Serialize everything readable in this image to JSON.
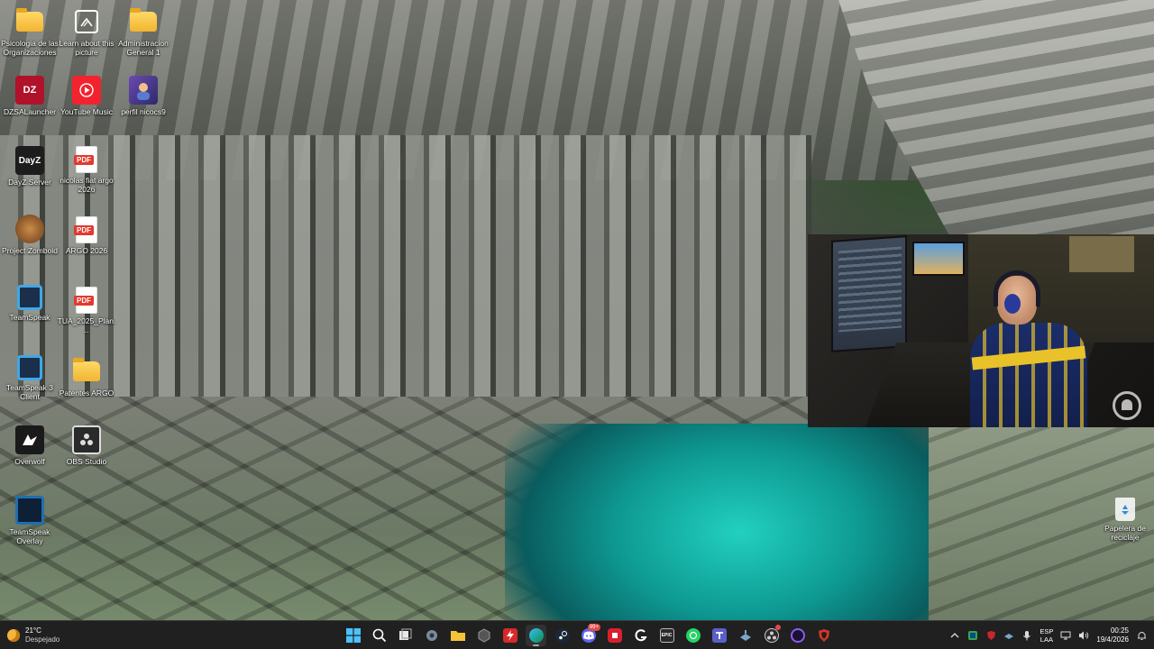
{
  "desktop": {
    "icons": [
      {
        "label": "Psicologia de las Organizaciones",
        "icon": "folder-icon"
      },
      {
        "label": "Learn about this picture",
        "icon": "camera-icon"
      },
      {
        "label": "Administracion General 1",
        "icon": "folder-icon"
      },
      {
        "label": "DZSALauncher",
        "icon": "dzsa-icon",
        "glyph": "DZ"
      },
      {
        "label": "YouTube Music",
        "icon": "youtube-music-icon"
      },
      {
        "label": "perfil nicocs9",
        "icon": "profile-image-icon"
      },
      {
        "label": "DayZ Server",
        "icon": "dayz-icon",
        "glyph": "DayZ"
      },
      {
        "label": "nicolas fiat argo 2026",
        "icon": "pdf-icon"
      },
      {
        "label": "Project Zomboid",
        "icon": "project-zomboid-icon"
      },
      {
        "label": "ARGO 2026",
        "icon": "pdf-icon"
      },
      {
        "label": "TeamSpeak",
        "icon": "teamspeak-icon"
      },
      {
        "label": "TUA_2025_Plan...",
        "icon": "pdf-icon"
      },
      {
        "label": "TeamSpeak 3 Client",
        "icon": "teamspeak-icon"
      },
      {
        "label": "Patentes ARGO",
        "icon": "folder-icon"
      },
      {
        "label": "Overwolf",
        "icon": "overwolf-icon"
      },
      {
        "label": "OBS Studio",
        "icon": "obs-icon"
      },
      {
        "label": "TeamSpeak Overlay",
        "icon": "teamspeak-overlay-icon"
      },
      {
        "label": "Papelera de reciclaje",
        "icon": "recycle-bin-icon"
      }
    ],
    "pdf_badge": "PDF"
  },
  "taskbar": {
    "weather": {
      "temp": "21°C",
      "condition": "Despejado",
      "icon": "moon-icon"
    },
    "apps": [
      {
        "name": "start",
        "icon": "windows-start-icon"
      },
      {
        "name": "search",
        "icon": "search-icon"
      },
      {
        "name": "task-view",
        "icon": "task-view-icon"
      },
      {
        "name": "settings",
        "icon": "settings-icon"
      },
      {
        "name": "file-explorer",
        "icon": "folder-icon"
      },
      {
        "name": "app-cube",
        "icon": "cube-icon"
      },
      {
        "name": "app-bolt",
        "icon": "lightning-icon"
      },
      {
        "name": "edge",
        "icon": "edge-icon",
        "active": true
      },
      {
        "name": "steam",
        "icon": "steam-icon"
      },
      {
        "name": "discord",
        "icon": "discord-icon",
        "badge": "99+"
      },
      {
        "name": "app-red",
        "icon": "app-red-icon"
      },
      {
        "name": "app-g",
        "icon": "g-hub-icon"
      },
      {
        "name": "epic-games",
        "icon": "epic-games-icon",
        "glyph": "EPIC"
      },
      {
        "name": "whatsapp",
        "icon": "whatsapp-icon"
      },
      {
        "name": "teams",
        "icon": "teams-icon"
      },
      {
        "name": "steam-2",
        "icon": "steam-icon"
      },
      {
        "name": "obs",
        "icon": "obs-icon"
      },
      {
        "name": "app-purple",
        "icon": "purple-circle-icon"
      },
      {
        "name": "app-shield",
        "icon": "shield-icon"
      }
    ],
    "tray": {
      "language_top": "ESP",
      "language_bottom": "LAA",
      "time": "00:25",
      "date": "19/4/2026"
    }
  },
  "webcam": {
    "label": "webcam-overlay"
  }
}
